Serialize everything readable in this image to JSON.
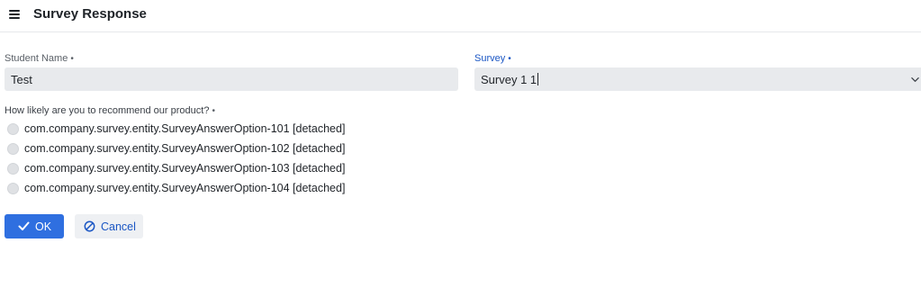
{
  "header": {
    "title": "Survey Response",
    "menu_icon": "hamburger-menu-icon"
  },
  "form": {
    "student_name": {
      "label": "Student Name",
      "required_mark": "•",
      "value": "Test"
    },
    "survey": {
      "label": "Survey",
      "required_mark": "•",
      "value": "Survey 1 1",
      "icon": "chevron-down-icon"
    },
    "question": {
      "label": "How likely are you to recommend our product?",
      "required_mark": "•",
      "options": [
        {
          "label": "com.company.survey.entity.SurveyAnswerOption-101 [detached]",
          "selected": false
        },
        {
          "label": "com.company.survey.entity.SurveyAnswerOption-102 [detached]",
          "selected": false
        },
        {
          "label": "com.company.survey.entity.SurveyAnswerOption-103 [detached]",
          "selected": false
        },
        {
          "label": "com.company.survey.entity.SurveyAnswerOption-104 [detached]",
          "selected": false
        }
      ]
    }
  },
  "actions": {
    "ok_label": "OK",
    "ok_icon": "checkmark-icon",
    "cancel_label": "Cancel",
    "cancel_icon": "ban-icon"
  },
  "colors": {
    "accent": "#2f6fe0",
    "link": "#1a56c4",
    "field_bg": "#e8eaed"
  }
}
